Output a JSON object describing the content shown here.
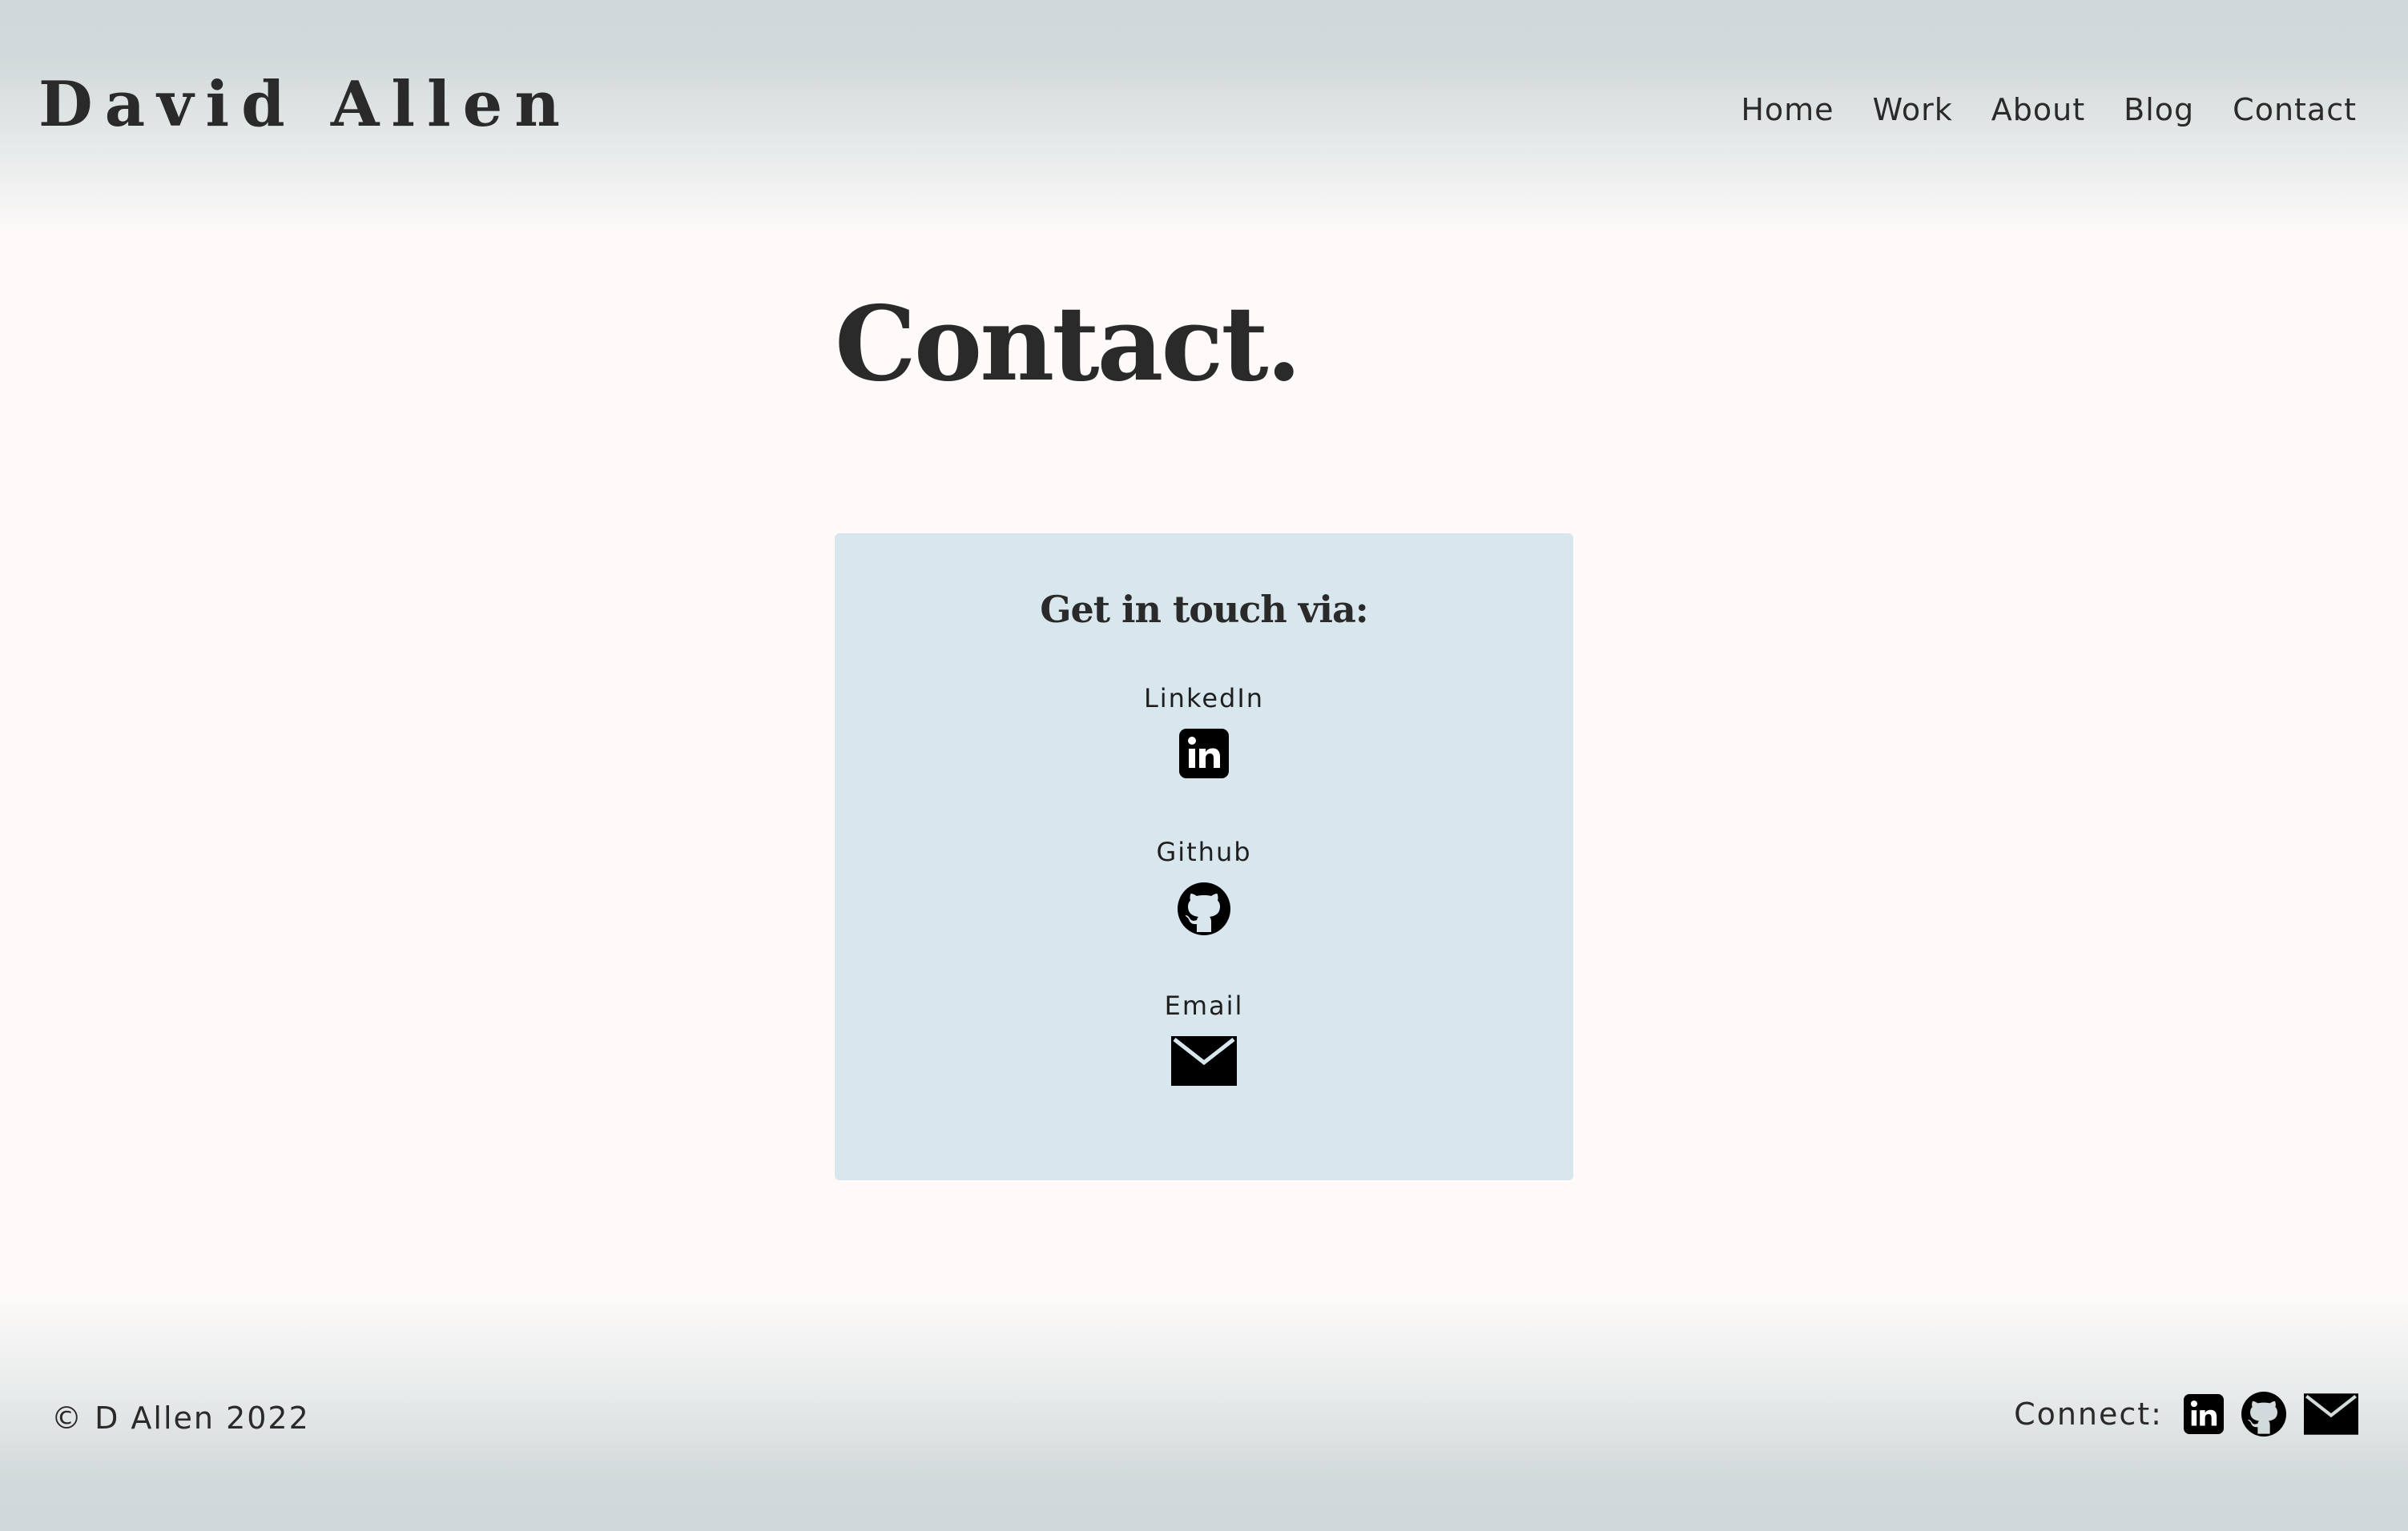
{
  "header": {
    "site_title": "David Allen",
    "nav": [
      {
        "label": "Home"
      },
      {
        "label": "Work"
      },
      {
        "label": "About"
      },
      {
        "label": "Blog"
      },
      {
        "label": "Contact"
      }
    ]
  },
  "main": {
    "page_heading": "Contact.",
    "card": {
      "heading": "Get in touch via:",
      "items": [
        {
          "label": "LinkedIn",
          "icon": "linkedin-icon"
        },
        {
          "label": "Github",
          "icon": "github-icon"
        },
        {
          "label": "Email",
          "icon": "mail-icon"
        }
      ]
    }
  },
  "footer": {
    "copyright": "© D Allen 2022",
    "connect_label": "Connect:",
    "icons": [
      "linkedin-icon",
      "github-icon",
      "mail-icon"
    ]
  },
  "colors": {
    "text": "#2b2a2a",
    "background": "#fdfaf9",
    "card": "#d8e6ed",
    "header_band": "#d0d8d9"
  }
}
